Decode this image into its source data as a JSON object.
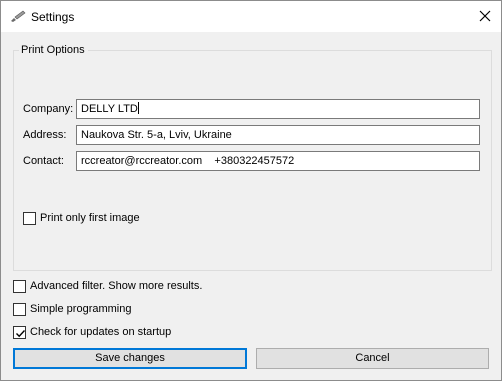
{
  "window": {
    "title": "Settings",
    "icon": "brush-icon"
  },
  "print_options": {
    "legend": "Print Options",
    "fields": [
      {
        "label": "Company:",
        "value": "DELLY LTD"
      },
      {
        "label": "Address:",
        "value": "Naukova Str. 5-a, Lviv, Ukraine"
      },
      {
        "label": "Contact:",
        "value": "rccreator@rccreator.com    +380322457572"
      }
    ],
    "print_first_only": {
      "label": "Print only first image",
      "checked": false
    }
  },
  "options": [
    {
      "label": "Advanced filter. Show more results.",
      "checked": false
    },
    {
      "label": "Simple programming",
      "checked": false
    },
    {
      "label": "Check for updates on startup",
      "checked": true
    }
  ],
  "buttons": {
    "save": "Save changes",
    "cancel": "Cancel"
  },
  "colors": {
    "focus_border": "#0078d7",
    "button_face": "#e1e1e1",
    "window_bg": "#f0f0f0"
  }
}
